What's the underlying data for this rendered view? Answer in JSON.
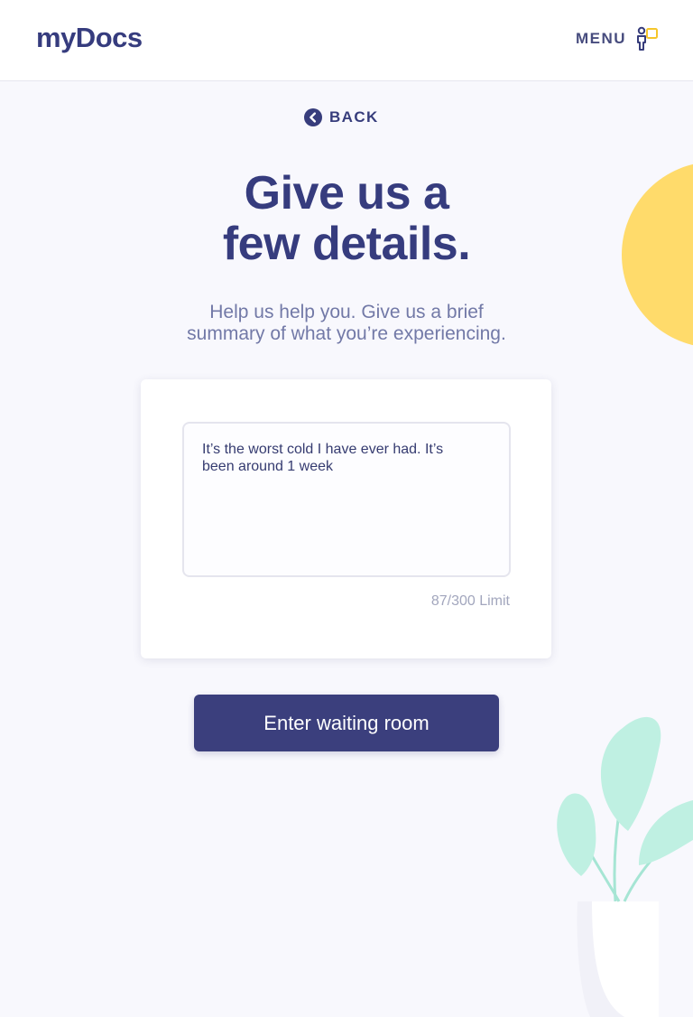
{
  "brand": {
    "logo_text": "myDocs"
  },
  "header": {
    "menu_label": "MENU",
    "menu_icon": "person-chat-icon",
    "accent_color": "#f5c62b"
  },
  "nav": {
    "back_label": "BACK",
    "back_icon": "chevron-left-circle-icon"
  },
  "main": {
    "title_line1": "Give us a",
    "title_line2": "few details.",
    "subtitle_line1": "Help us help you. Give us a brief",
    "subtitle_line2": "summary of what you’re experiencing."
  },
  "form": {
    "summary_line1": "It’s the worst cold I have ever had. It’s",
    "summary_line2": "been around 1 week",
    "char_limit": "87/300 Limit",
    "submit_label": "Enter waiting room"
  },
  "colors": {
    "primary": "#3b3f7d",
    "background": "#f8f8fd",
    "sun": "#ffdb6b",
    "leaf": "#bff0e2"
  }
}
